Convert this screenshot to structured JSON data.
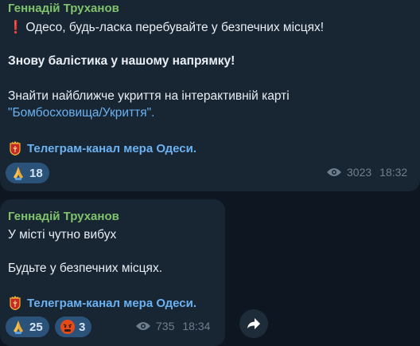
{
  "messages": [
    {
      "sender": "Геннадій Труханов",
      "line1": "Одесо, будь-ласка перебувайте у безпечних місцях!",
      "line2": "Знову балістика у нашому напрямку!",
      "line3": "Знайти найближче укриття на інтерактивній карті",
      "link": "\"Бомбосховища/Укриття\".",
      "channel": "Телеграм-канал мера Одеси.",
      "reactions": [
        {
          "icon": "praying-hands-icon",
          "count": "18"
        }
      ],
      "views": "3023",
      "time": "18:32"
    },
    {
      "sender": "Геннадій Труханов",
      "line1": "У місті чутно вибух",
      "line2": "Будьте у безпечних місцях.",
      "channel": "Телеграм-канал мера Одеси.",
      "reactions": [
        {
          "icon": "praying-hands-icon",
          "count": "25"
        },
        {
          "icon": "angry-face-icon",
          "count": "3"
        }
      ],
      "views": "735",
      "time": "18:34"
    }
  ],
  "colors": {
    "background": "#0e1621",
    "bubble": "#182533",
    "sender": "#7fc36b",
    "link": "#6ab2f2",
    "reaction_bg": "#2b5278",
    "meta": "#6d7f8f"
  }
}
